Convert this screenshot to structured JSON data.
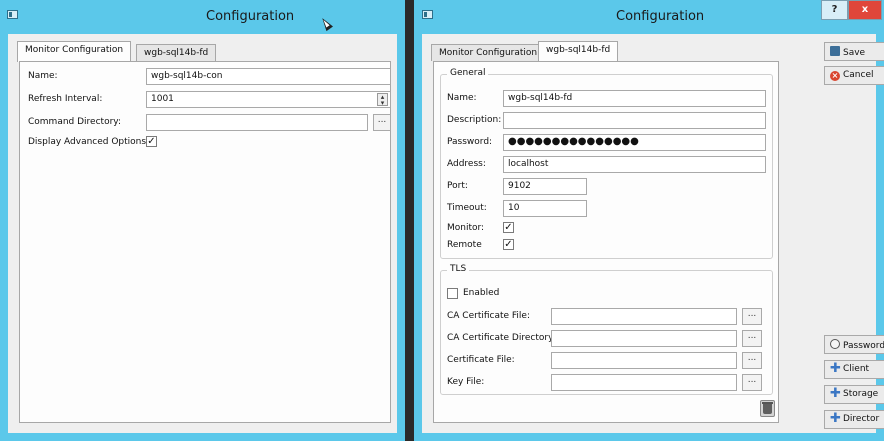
{
  "left_window": {
    "title": "Configuration",
    "tabs": [
      "Monitor Configuration",
      "wgb-sql14b-fd"
    ],
    "active_tab": 0,
    "fields": {
      "name_label": "Name:",
      "name_value": "wgb-sql14b-con",
      "refresh_label": "Refresh Interval:",
      "refresh_value": "1001",
      "command_dir_label": "Command Directory:",
      "command_dir_value": "",
      "advanced_label": "Display Advanced Options:",
      "advanced_checked": true
    },
    "browse_label": "..."
  },
  "right_window": {
    "title": "Configuration",
    "help_label": "?",
    "close_label": "x",
    "tabs": [
      "Monitor Configuration",
      "wgb-sql14b-fd"
    ],
    "active_tab": 1,
    "general": {
      "title": "General",
      "name_label": "Name:",
      "name_value": "wgb-sql14b-fd",
      "description_label": "Description:",
      "description_value": "",
      "password_label": "Password:",
      "password_value": "●●●●●●●●●●●●●●●",
      "address_label": "Address:",
      "address_value": "localhost",
      "port_label": "Port:",
      "port_value": "9102",
      "timeout_label": "Timeout:",
      "timeout_value": "10",
      "monitor_label": "Monitor:",
      "monitor_checked": true,
      "remote_label": "Remote",
      "remote_checked": true
    },
    "tls": {
      "title": "TLS",
      "enabled_label": "Enabled",
      "enabled_checked": false,
      "ca_file_label": "CA Certificate File:",
      "ca_dir_label": "CA Certificate Directory:",
      "cert_file_label": "Certificate File:",
      "key_file_label": "Key File:",
      "browse_label": "..."
    },
    "side_buttons": {
      "save": "Save",
      "cancel": "Cancel",
      "password": "Password",
      "client": "Client",
      "storage": "Storage",
      "director": "Director"
    },
    "icons": {
      "save": "save-icon",
      "cancel": "cancel-icon",
      "password": "key-icon",
      "client": "plus-icon",
      "storage": "plus-icon",
      "director": "plus-icon",
      "delete": "trash-icon"
    }
  },
  "colors": {
    "titlebar": "#5bc8ea",
    "close_button": "#e0463a"
  }
}
